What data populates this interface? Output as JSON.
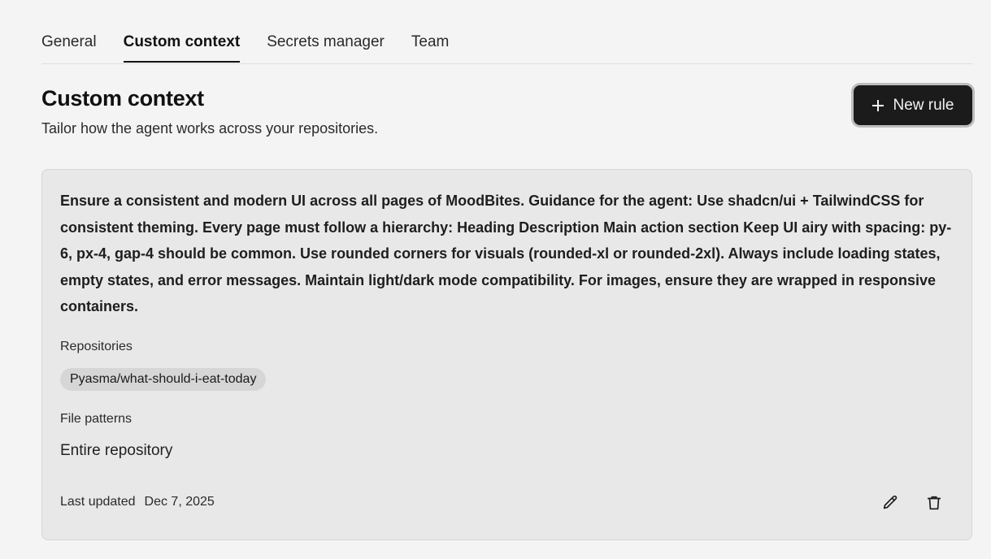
{
  "tabs": [
    {
      "label": "General",
      "active": false
    },
    {
      "label": "Custom context",
      "active": true
    },
    {
      "label": "Secrets manager",
      "active": false
    },
    {
      "label": "Team",
      "active": false
    }
  ],
  "header": {
    "title": "Custom context",
    "subtitle": "Tailor how the agent works across your repositories.",
    "new_rule_label": "New rule",
    "new_rule_icon": "plus-icon"
  },
  "rule": {
    "text": "Ensure a consistent and modern UI across all pages of MoodBites. Guidance for the agent: Use shadcn/ui + TailwindCSS for consistent theming. Every page must follow a hierarchy: Heading Description Main action section Keep UI airy with spacing: py-6, px-4, gap-4 should be common. Use rounded corners for visuals (rounded-xl or rounded-2xl). Always include loading states, empty states, and error messages. Maintain light/dark mode compatibility. For images, ensure they are wrapped in responsive containers.",
    "repositories_label": "Repositories",
    "repositories": [
      "Pyasma/what-should-i-eat-today"
    ],
    "file_patterns_label": "File patterns",
    "file_patterns_value": "Entire repository",
    "last_updated_label": "Last updated",
    "last_updated_value": "Dec 7, 2025",
    "edit_icon": "pencil-icon",
    "delete_icon": "trash-icon"
  },
  "colors": {
    "background": "#f4f4f4",
    "card": "#e8e8e8",
    "button": "#1b1b1b",
    "chip": "#d6d6d6"
  }
}
